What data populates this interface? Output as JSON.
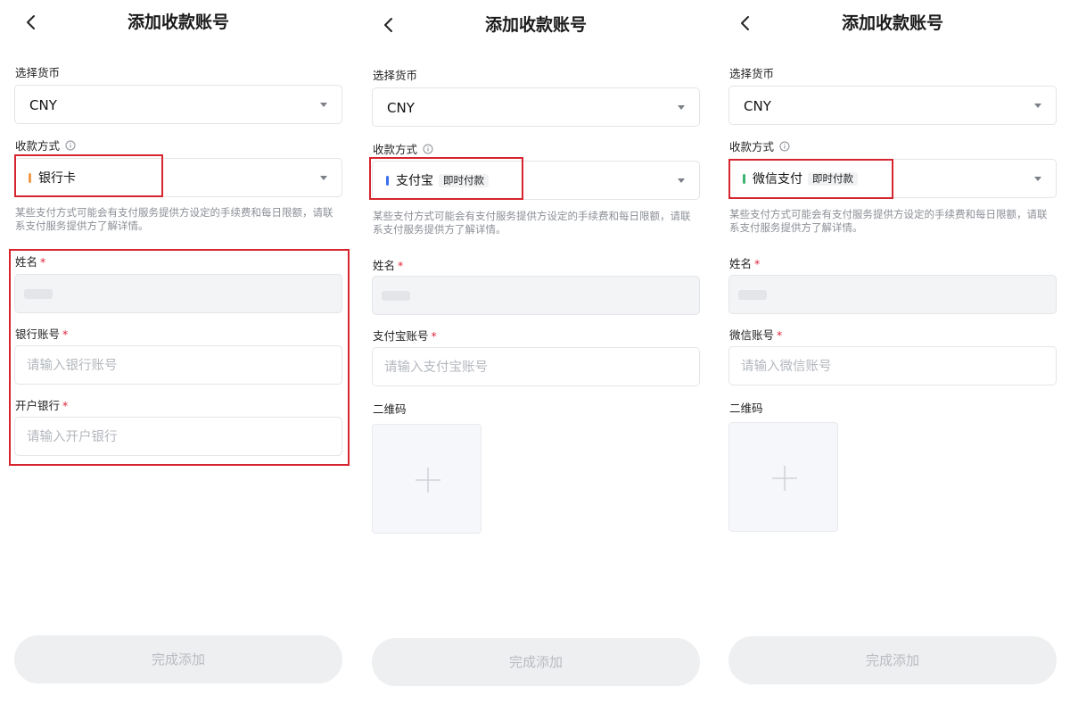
{
  "panels": [
    {
      "title": "添加收款账号",
      "currency": {
        "label": "选择货币",
        "value": "CNY"
      },
      "method": {
        "label": "收款方式",
        "name": "银行卡",
        "tag": "",
        "color": "#f29a4a"
      },
      "hint": "某些支付方式可能会有支付服务提供方设定的手续费和每日限额，请联系支付服务提供方了解详情。",
      "name_field": {
        "label": "姓名"
      },
      "account_field": {
        "label": "银行账号",
        "placeholder": "请输入银行账号"
      },
      "bank_field": {
        "label": "开户银行",
        "placeholder": "请输入开户银行"
      },
      "submit": "完成添加"
    },
    {
      "title": "添加收款账号",
      "currency": {
        "label": "选择货币",
        "value": "CNY"
      },
      "method": {
        "label": "收款方式",
        "name": "支付宝",
        "tag": "即时付款",
        "color": "#3c6ff0"
      },
      "hint": "某些支付方式可能会有支付服务提供方设定的手续费和每日限额，请联系支付服务提供方了解详情。",
      "name_field": {
        "label": "姓名"
      },
      "account_field": {
        "label": "支付宝账号",
        "placeholder": "请输入支付宝账号"
      },
      "qr": {
        "label": "二维码"
      },
      "submit": "完成添加"
    },
    {
      "title": "添加收款账号",
      "currency": {
        "label": "选择货币",
        "value": "CNY"
      },
      "method": {
        "label": "收款方式",
        "name": "微信支付",
        "tag": "即时付款",
        "color": "#3cb371"
      },
      "hint": "某些支付方式可能会有支付服务提供方设定的手续费和每日限额，请联系支付服务提供方了解详情。",
      "name_field": {
        "label": "姓名"
      },
      "account_field": {
        "label": "微信账号",
        "placeholder": "请输入微信账号"
      },
      "qr": {
        "label": "二维码"
      },
      "submit": "完成添加"
    }
  ],
  "required_mark": "*",
  "icons": {
    "back": "chevron-left-icon",
    "info": "info-icon",
    "caret": "caret-down-icon",
    "add": "plus-icon"
  }
}
